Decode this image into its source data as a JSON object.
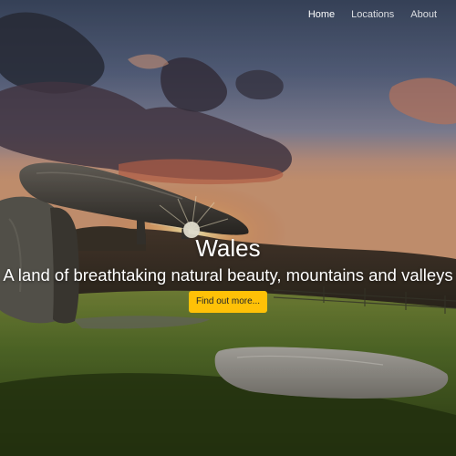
{
  "nav": {
    "items": [
      {
        "label": "Home",
        "active": true
      },
      {
        "label": "Locations",
        "active": false
      },
      {
        "label": "About",
        "active": false
      }
    ]
  },
  "hero": {
    "title": "Wales",
    "subtitle": "A land of breathtaking natural beauty, mountains and valleys",
    "cta_label": "Find out more...",
    "background": "photo of a stone dolmen at sunset"
  },
  "colors": {
    "accent": "#ffc107",
    "nav_text": "#ffffff"
  }
}
